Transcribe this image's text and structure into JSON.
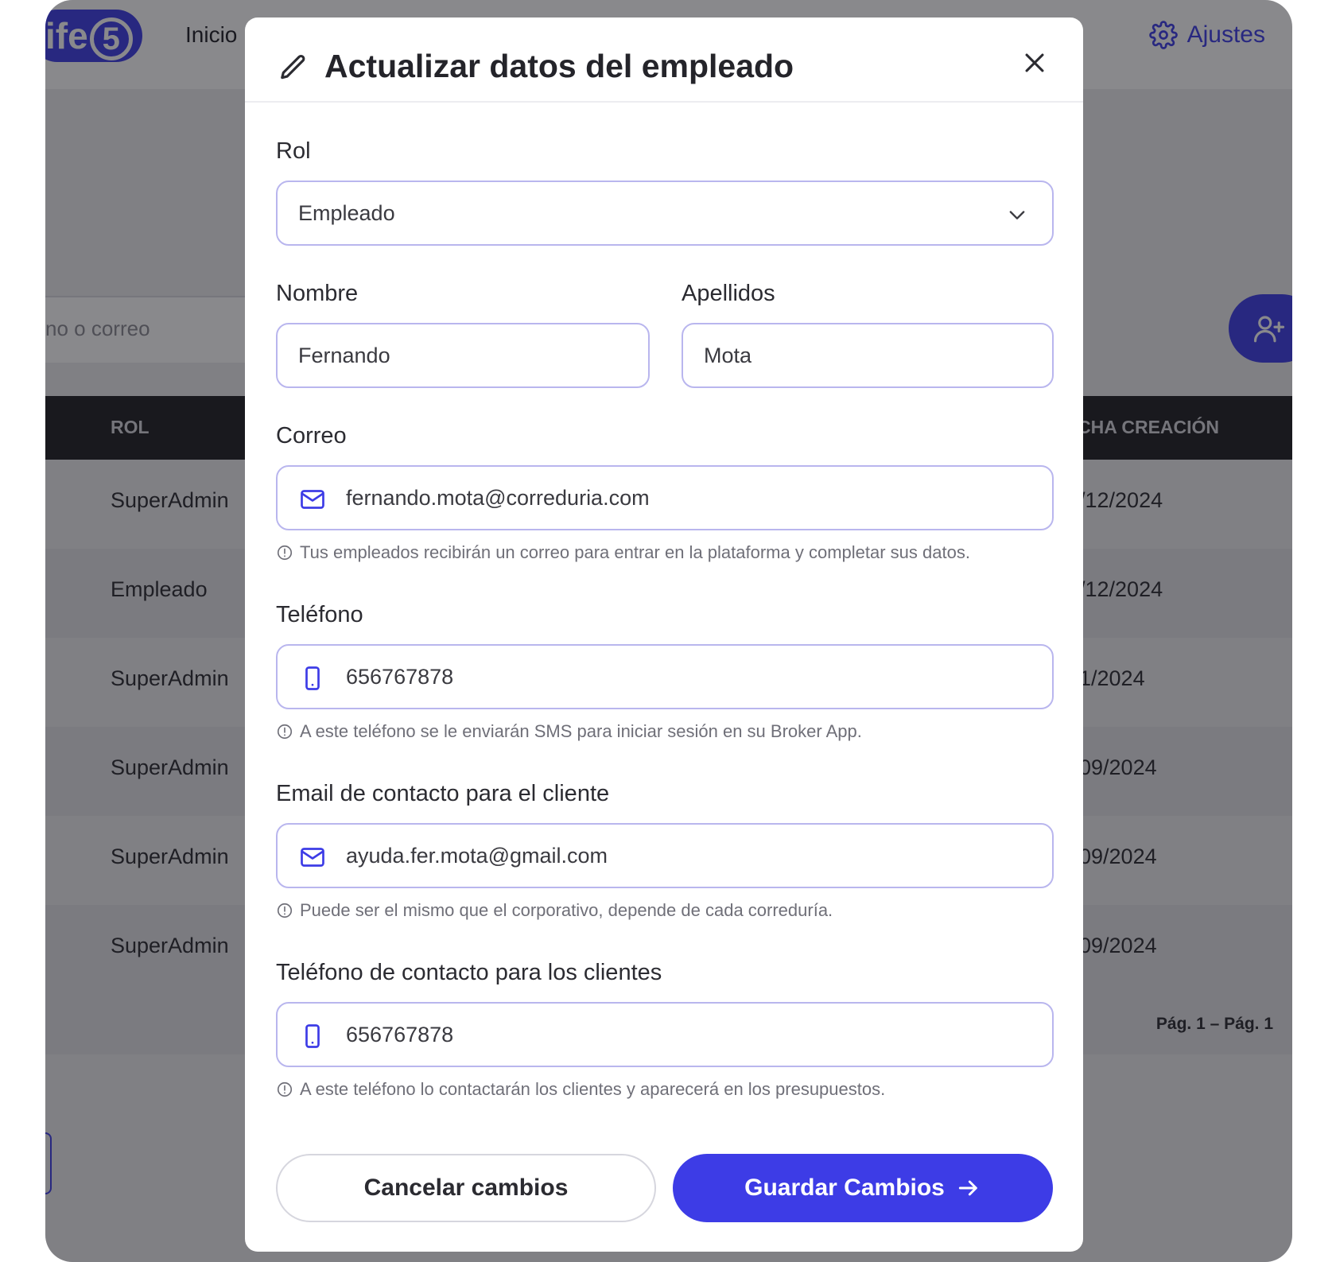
{
  "background": {
    "logo_text": "ife",
    "logo_number": "5",
    "nav": {
      "inicio": "Inicio"
    },
    "settings_label": "Ajustes",
    "search_placeholder_fragment": "no o correo",
    "table": {
      "col_rol": "ROL",
      "col_fecha": "CHA CREACIÓN",
      "rows": [
        {
          "rol": "SuperAdmin",
          "fecha": "/12/2024"
        },
        {
          "rol": "Empleado",
          "fecha": "/12/2024"
        },
        {
          "rol": "SuperAdmin",
          "fecha": "1/2024"
        },
        {
          "rol": "SuperAdmin",
          "fecha": "09/2024"
        },
        {
          "rol": "SuperAdmin",
          "fecha": "09/2024"
        },
        {
          "rol": "SuperAdmin",
          "fecha": "09/2024"
        }
      ]
    },
    "pagination": "Pág. 1 – Pág. 1"
  },
  "modal": {
    "title": "Actualizar datos del empleado",
    "rol": {
      "label": "Rol",
      "value": "Empleado"
    },
    "nombre": {
      "label": "Nombre",
      "value": "Fernando"
    },
    "apellidos": {
      "label": "Apellidos",
      "value": "Mota"
    },
    "correo": {
      "label": "Correo",
      "value": "fernando.mota@correduria.com",
      "hint": "Tus empleados recibirán un correo para entrar en la plataforma y completar sus datos."
    },
    "telefono": {
      "label": "Teléfono",
      "value": "656767878",
      "hint": "A este teléfono se le enviarán SMS para iniciar sesión en su Broker App."
    },
    "email_cliente": {
      "label": "Email de contacto para el cliente",
      "value": "ayuda.fer.mota@gmail.com",
      "hint": "Puede ser el mismo que el corporativo, depende de cada correduría."
    },
    "telefono_cliente": {
      "label": "Teléfono de contacto para los clientes",
      "value": "656767878",
      "hint": "A este teléfono lo contactarán los clientes y aparecerá en los presupuestos."
    },
    "cancel_label": "Cancelar cambios",
    "save_label": "Guardar Cambios"
  },
  "icons": {
    "edit": "pencil-icon",
    "close": "close-icon",
    "mail": "mail-icon",
    "phone": "phone-icon",
    "info": "info-icon",
    "chevron": "chevron-down-icon",
    "arrow": "arrow-right-icon",
    "settings": "gear-icon",
    "add_user": "add-user-icon"
  },
  "colors": {
    "accent": "#3d3ce6",
    "field_border": "#b9b6ee",
    "table_header": "#1e1e22"
  }
}
